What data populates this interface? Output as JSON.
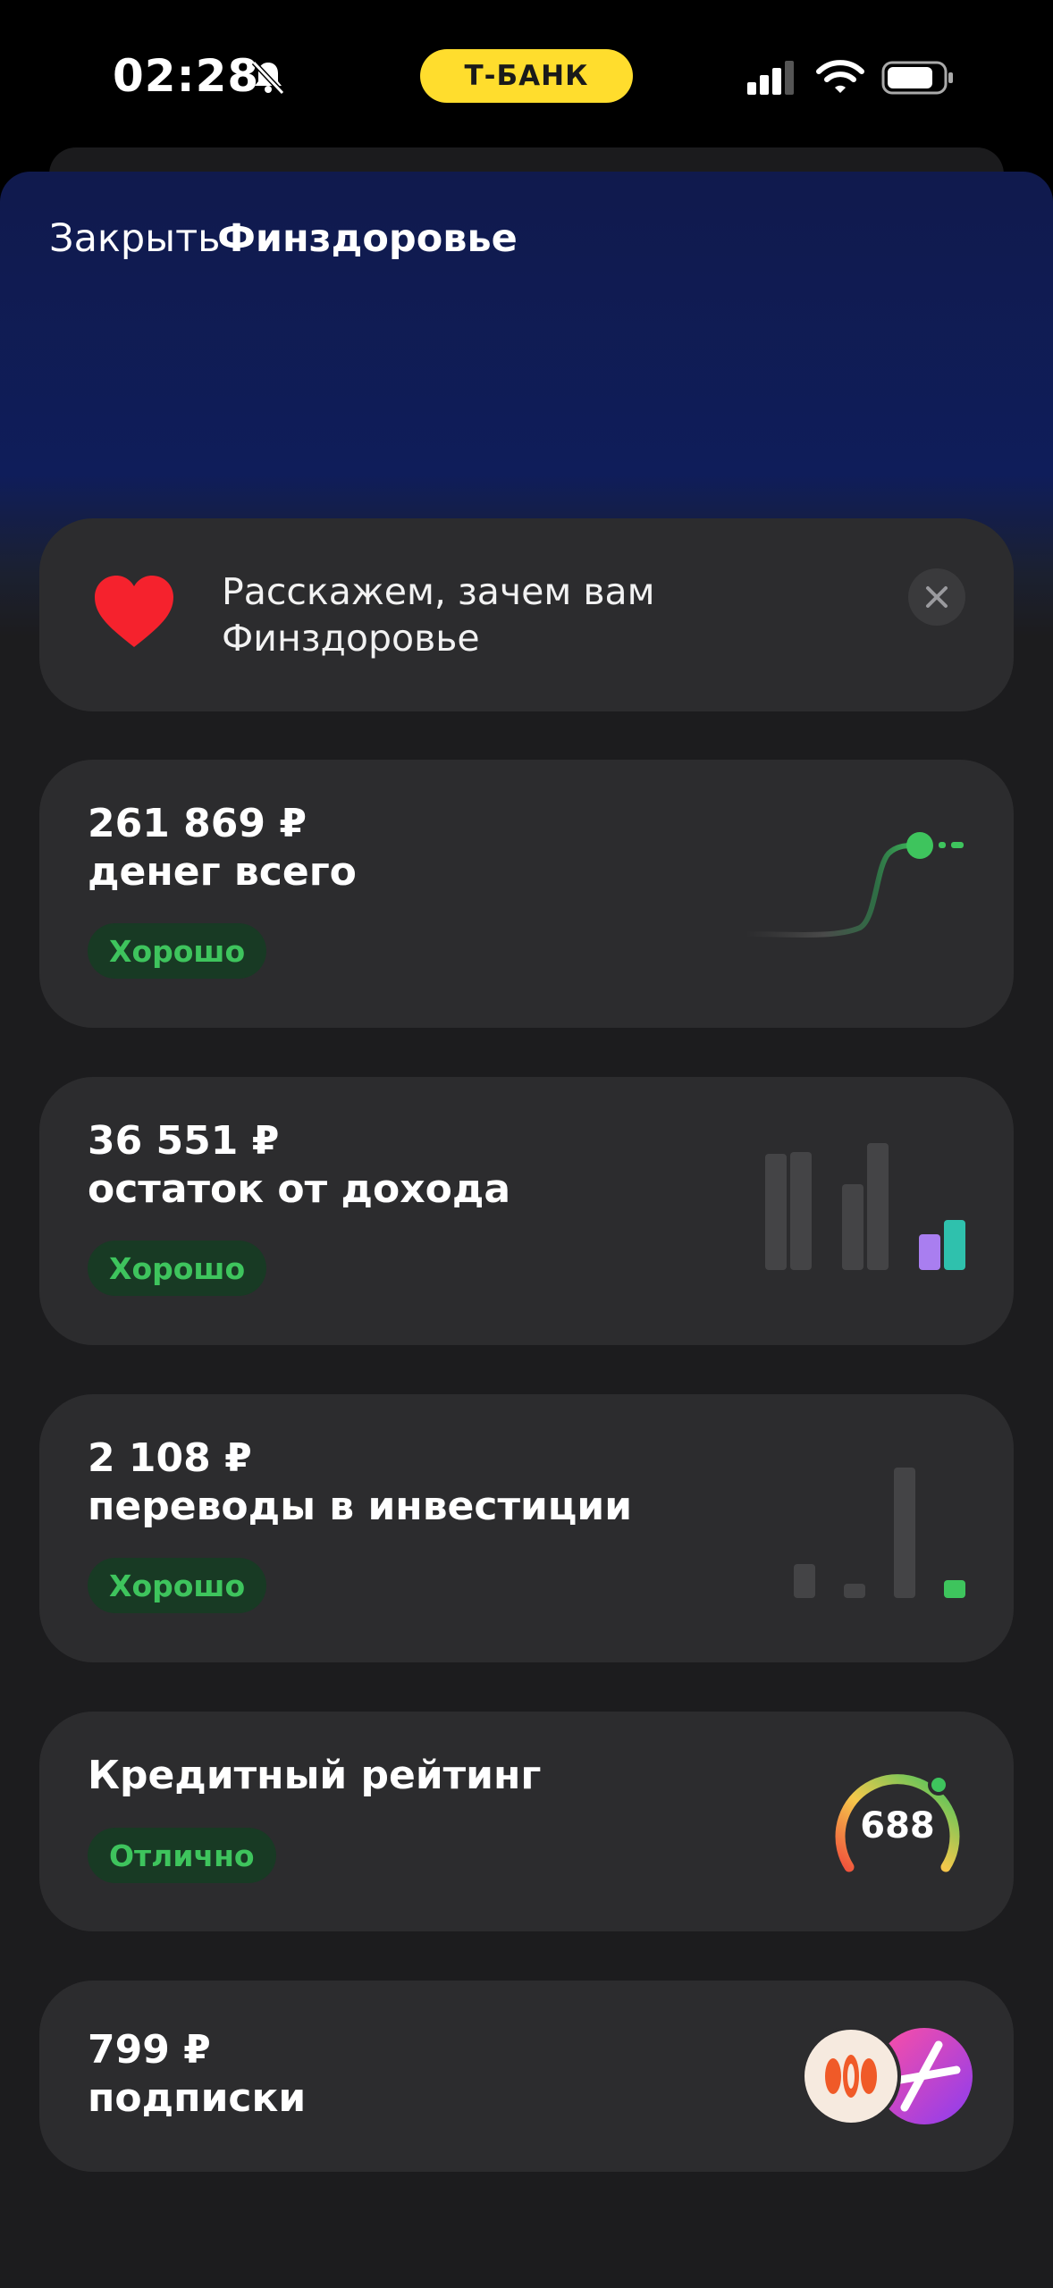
{
  "status_bar": {
    "time": "02:28",
    "carrier_pill": "Т-БАНК"
  },
  "header": {
    "close_label": "Закрыть",
    "title": "Финздоровье"
  },
  "promo": {
    "text": "Расскажем, зачем вам Финздоровье",
    "icon": "heart-icon",
    "close_icon": "close-icon"
  },
  "cards": [
    {
      "amount": "261 869 ₽",
      "label": "денег всего",
      "badge": "Хорошо",
      "visual": "trend-line-chart"
    },
    {
      "amount": "36 551 ₽",
      "label": "остаток от дохода",
      "badge": "Хорошо",
      "visual": "income-bar-chart"
    },
    {
      "amount": "2 108 ₽",
      "label": "переводы в инвестиции",
      "badge": "Хорошо",
      "visual": "investment-bar-chart"
    },
    {
      "label": "Кредитный рейтинг",
      "badge": "Отлично",
      "score": "688",
      "visual": "credit-gauge"
    },
    {
      "amount": "799 ₽",
      "label": "подписки",
      "visual": "subscription-logos"
    }
  ],
  "colors": {
    "accent_yellow": "#ffdd2d",
    "good_green": "#3ec45d",
    "header_blue": "#0f1d5a",
    "card_bg": "#2c2c2e"
  }
}
